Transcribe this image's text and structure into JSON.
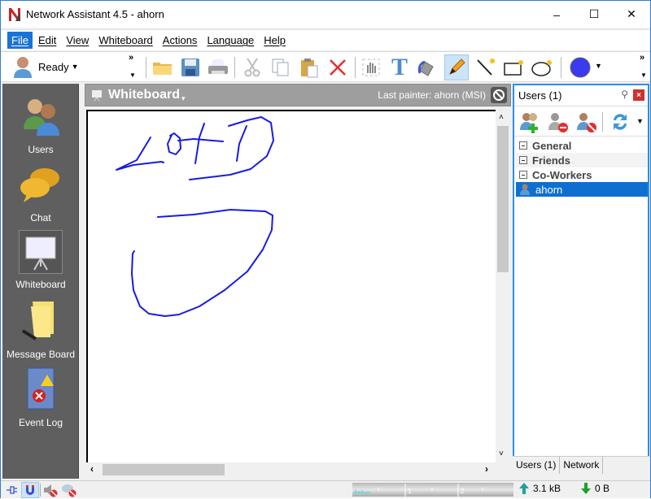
{
  "window": {
    "title": "Network Assistant 4.5 - ahorn",
    "controls": {
      "minimize": "–",
      "maximize": "☐",
      "close": "✕"
    }
  },
  "menu": [
    "File",
    "Edit",
    "View",
    "Whiteboard",
    "Actions",
    "Language",
    "Help"
  ],
  "toolbar": {
    "status_label": "Ready",
    "overflow": "»",
    "tools": [
      "open-folder",
      "save",
      "print",
      "cut",
      "copy",
      "paste",
      "delete",
      "select-hand",
      "text",
      "fill",
      "pencil",
      "line",
      "rectangle",
      "ellipse",
      "color"
    ],
    "selected_tool": "pencil",
    "current_color": "#3a3af0"
  },
  "sidebar": {
    "items": [
      {
        "label": "Users",
        "icon": "users-icon"
      },
      {
        "label": "Chat",
        "icon": "chat-icon"
      },
      {
        "label": "Whiteboard",
        "icon": "whiteboard-icon",
        "active": true
      },
      {
        "label": "Message Board",
        "icon": "note-icon"
      },
      {
        "label": "Event Log",
        "icon": "event-log-icon"
      }
    ]
  },
  "whiteboard": {
    "title": "Whiteboard",
    "last_painter": "Last painter: ahorn (MSI)",
    "stroke_color": "#1a1ae6",
    "drawn_text": "LO4D"
  },
  "users_panel": {
    "title": "Users (1)",
    "groups": [
      "General",
      "Friends",
      "Co-Workers"
    ],
    "users": [
      {
        "name": "ahorn",
        "selected": true
      }
    ],
    "tabs": [
      "Users (1)",
      "Network"
    ]
  },
  "statusbar": {
    "meter_ticks": [
      "1",
      "2"
    ],
    "upload": "3.1 kB",
    "download": "0 B"
  },
  "colors": {
    "accent": "#1a73d6",
    "sidebar_bg": "#5f5f5f",
    "header_bg": "#9e9e9e",
    "panel_border": "#2b8fe6"
  }
}
